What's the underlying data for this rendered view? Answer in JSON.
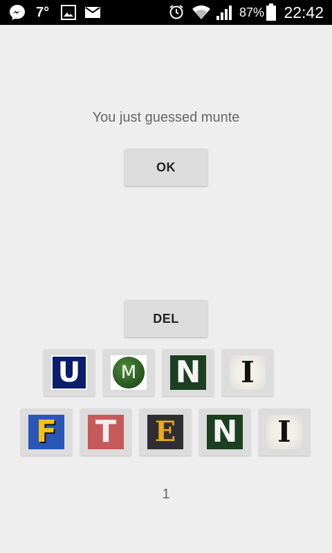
{
  "status_bar": {
    "temperature": "7°",
    "battery": "87%",
    "time": "22:42",
    "icons": [
      "messenger-icon",
      "picture-icon",
      "mail-icon",
      "alarm-icon",
      "wifi-icon",
      "signal-icon",
      "battery-icon"
    ]
  },
  "message": "You just guessed munte",
  "ok_label": "OK",
  "del_label": "DEL",
  "row1": [
    {
      "letter": "U",
      "style": "navy"
    },
    {
      "letter": "M",
      "style": "green-circle"
    },
    {
      "letter": "N",
      "style": "dark-green"
    },
    {
      "letter": "I",
      "style": "black-serif"
    }
  ],
  "row2": [
    {
      "letter": "F",
      "style": "yellow-on-blue"
    },
    {
      "letter": "T",
      "style": "white-on-red"
    },
    {
      "letter": "E",
      "style": "yellow-on-black"
    },
    {
      "letter": "N",
      "style": "dark-green"
    },
    {
      "letter": "I",
      "style": "black-serif"
    }
  ],
  "page_number": "1",
  "colors": {
    "background": "#eeeeee",
    "button": "#dcdcdc",
    "text_secondary": "#666666"
  }
}
